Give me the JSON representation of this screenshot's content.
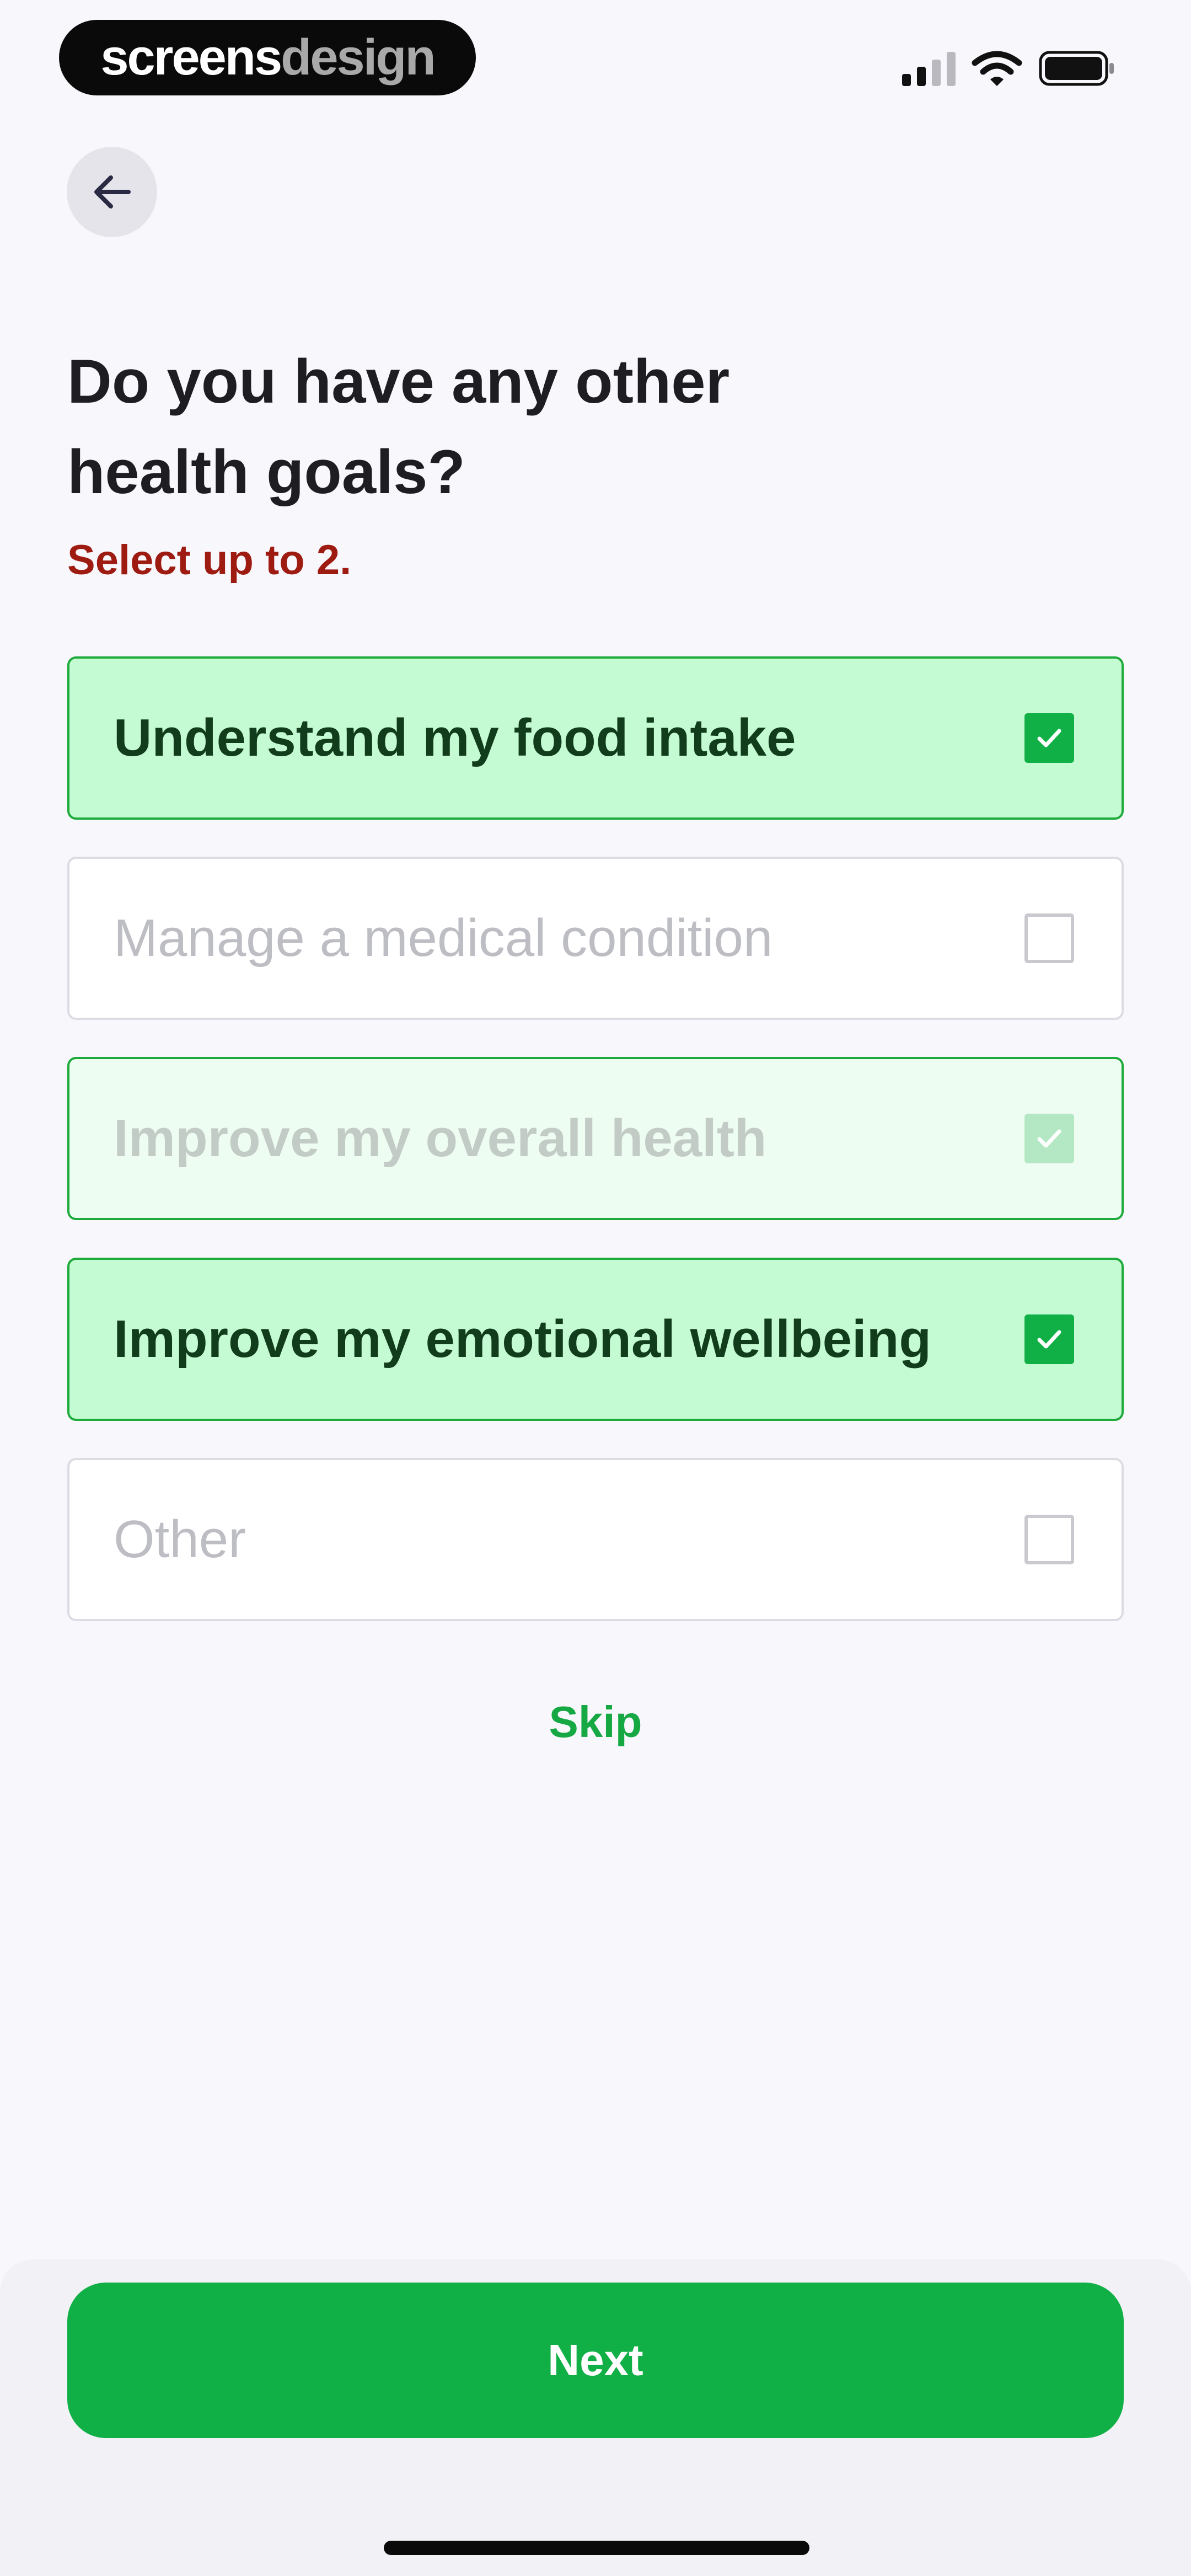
{
  "status_bar": {
    "brand_part1": "screens",
    "brand_part2": "design"
  },
  "header": {
    "title_line1": "Do you have any other",
    "title_line2": "health goals?",
    "subtitle": "Select up to 2."
  },
  "options": [
    {
      "label": "Understand my food intake",
      "state": "selected",
      "checked": true
    },
    {
      "label": "Manage a medical condition",
      "state": "unselected",
      "checked": false
    },
    {
      "label": "Improve my overall health",
      "state": "deselecting",
      "checked": true
    },
    {
      "label": "Improve my emotional wellbeing",
      "state": "selected",
      "checked": true
    },
    {
      "label": "Other",
      "state": "unselected",
      "checked": false
    }
  ],
  "skip_label": "Skip",
  "next_label": "Next",
  "icons": {
    "back": "arrow-left-icon",
    "check": "checkmark-icon",
    "signal": "cellular-signal-icon",
    "wifi": "wifi-icon",
    "battery": "battery-icon"
  },
  "colors": {
    "accent_green": "#11B047",
    "selected_fill": "#C5FBD2",
    "subtitle_red": "#9E1B12",
    "background": "#F7F7FC"
  }
}
